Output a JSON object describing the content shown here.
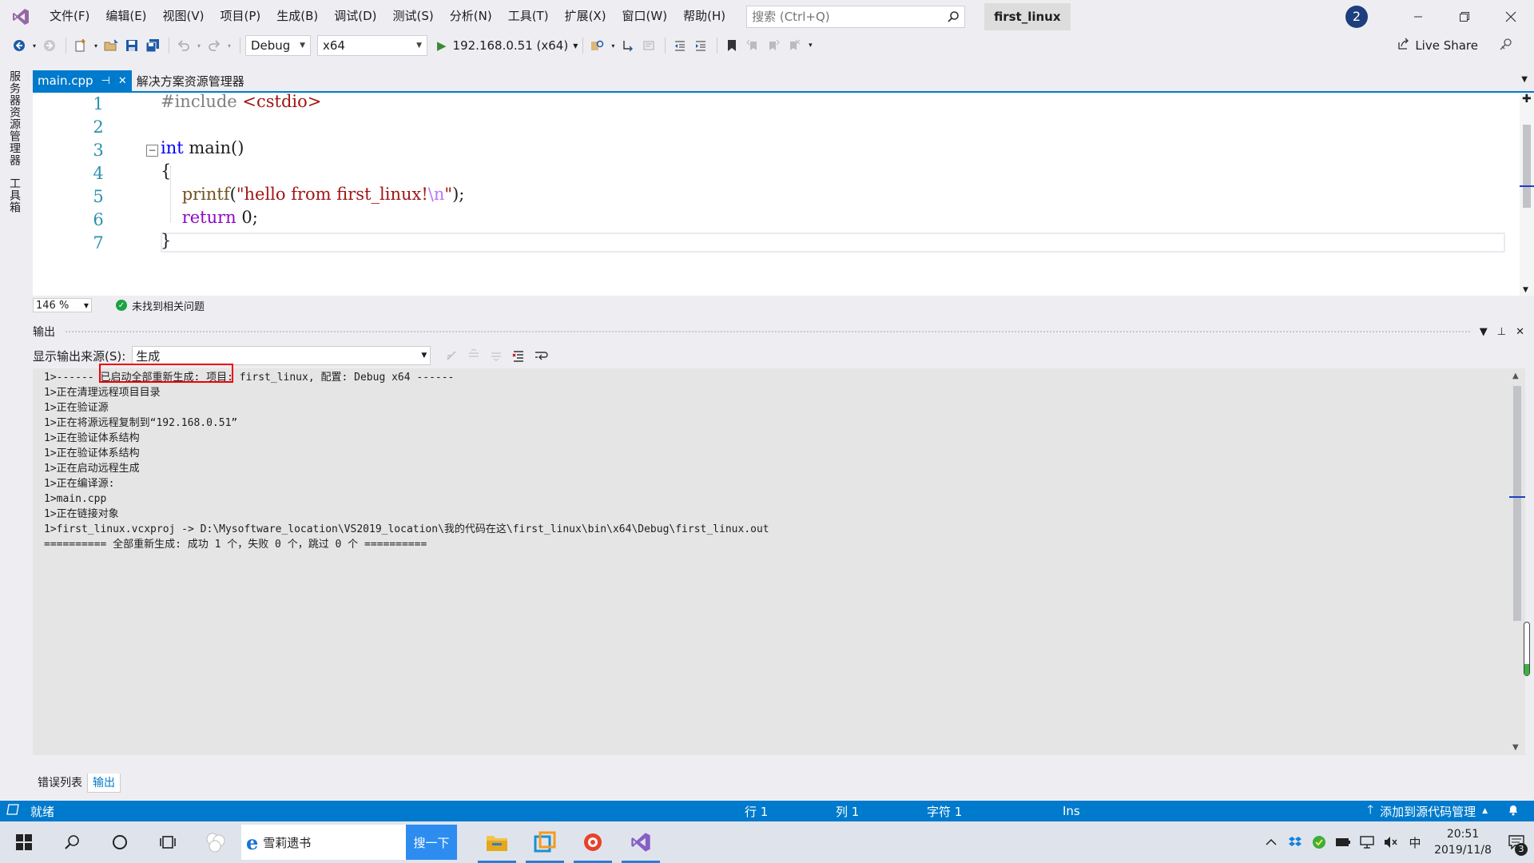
{
  "window": {
    "menu": [
      "文件(F)",
      "编辑(E)",
      "视图(V)",
      "项目(P)",
      "生成(B)",
      "调试(D)",
      "测试(S)",
      "分析(N)",
      "工具(T)",
      "扩展(X)",
      "窗口(W)",
      "帮助(H)"
    ],
    "search_placeholder": "搜索 (Ctrl+Q)",
    "solution_name": "first_linux",
    "notification_count": "2"
  },
  "toolbar": {
    "config": "Debug",
    "platform": "x64",
    "run_target": "192.168.0.51 (x64)",
    "live_share": "Live Share"
  },
  "left_strip": {
    "server_explorer": "服务器资源管理器",
    "toolbox": "工具箱"
  },
  "doc_tabs": {
    "active": "main.cpp",
    "inactive": "解决方案资源管理器"
  },
  "editor": {
    "line_numbers": [
      "1",
      "2",
      "3",
      "4",
      "5",
      "6",
      "7"
    ],
    "zoom": "146 %",
    "issues": "未找到相关问题"
  },
  "output": {
    "title": "输出",
    "source_label": "显示输出来源(S):",
    "source_value": "生成",
    "lines": [
      "1>------ 已启动全部重新生成: 项目: first_linux, 配置: Debug x64 ------",
      "1>正在清理远程项目目录",
      "1>正在验证源",
      "1>正在将源远程复制到“192.168.0.51”",
      "1>正在验证体系结构",
      "1>正在验证体系结构",
      "1>正在启动远程生成",
      "1>正在编译源:",
      "1>main.cpp",
      "1>正在链接对象",
      "1>first_linux.vcxproj -> D:\\Mysoftware_location\\VS2019_location\\我的代码在这\\first_linux\\bin\\x64\\Debug\\first_linux.out",
      "========== 全部重新生成: 成功 1 个，失败 0 个，跳过 0 个 =========="
    ]
  },
  "bottom_tabs": [
    "错误列表",
    "输出"
  ],
  "statusbar": {
    "ready": "就绪",
    "line": "行 1",
    "col": "列 1",
    "char": "字符 1",
    "mode": "Ins",
    "source_control": "添加到源代码管理"
  },
  "taskbar": {
    "browser_text": "雪莉遗书",
    "search_button": "搜一下",
    "ime": "中",
    "time": "20:51",
    "date": "2019/11/8",
    "action_center_count": "3"
  },
  "colors": {
    "accent": "#007acc",
    "highlight_box": "#ee0000"
  }
}
